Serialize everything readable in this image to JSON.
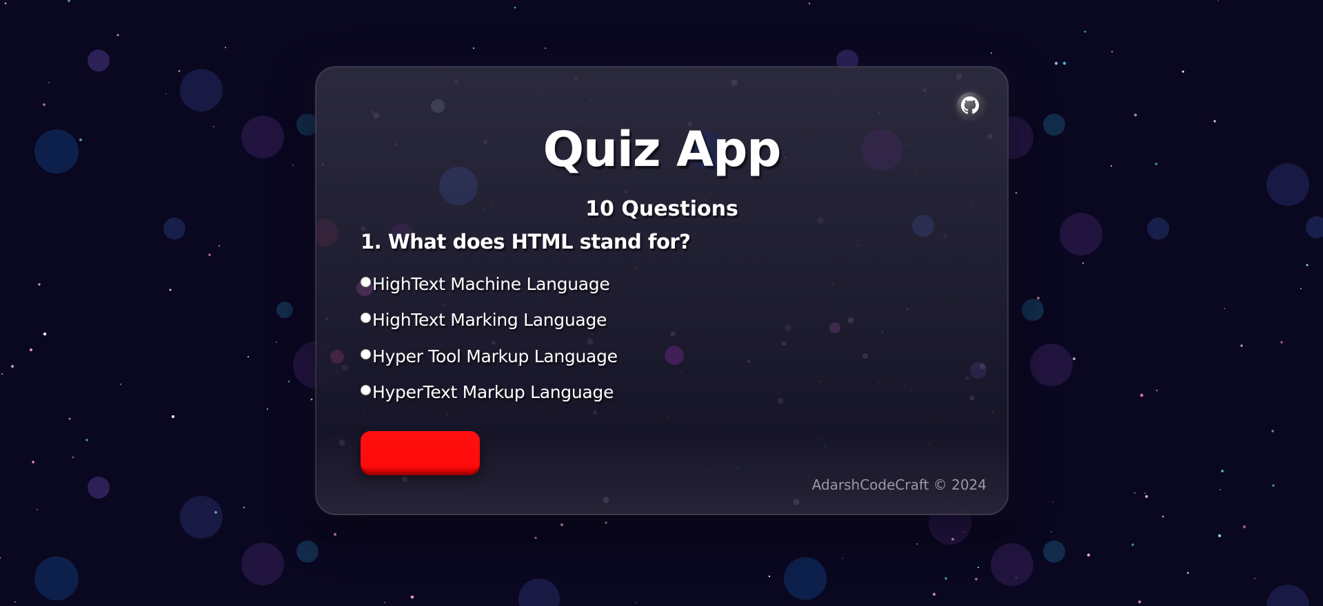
{
  "app": {
    "title": "Quiz App",
    "subtitle": "10 Questions",
    "github_icon": "github-icon"
  },
  "quiz": {
    "question": "1. What does HTML stand for?",
    "options": [
      {
        "label": "HighText Machine Language",
        "selected": false
      },
      {
        "label": "HighText Marking Language",
        "selected": false
      },
      {
        "label": "Hyper Tool Markup Language",
        "selected": false
      },
      {
        "label": "HyperText Markup Language",
        "selected": false
      }
    ],
    "submit_label": ""
  },
  "footer": {
    "text": "AdarshCodeCraft © 2024"
  },
  "colors": {
    "background": "#0a0720",
    "card": "#201e30",
    "accent_button": "#ff0a0a",
    "text": "#ffffff",
    "footer_text": "#9c9aa6"
  }
}
